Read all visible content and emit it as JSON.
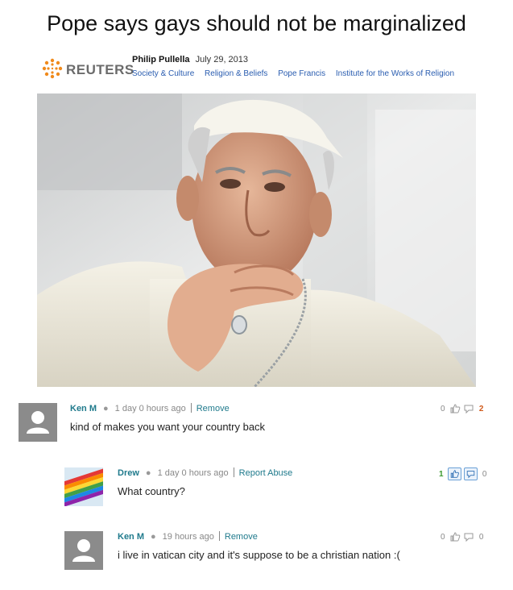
{
  "article": {
    "headline": "Pope says gays should not be marginalized",
    "source_logo_text": "REUTERS",
    "author": "Philip Pullella",
    "date": "July 29, 2013",
    "tags": [
      "Society & Culture",
      "Religion & Beliefs",
      "Pope Francis",
      "Institute for the Works of Religion"
    ]
  },
  "comments": [
    {
      "user": "Ken M",
      "time": "1 day 0 hours ago",
      "action": "Remove",
      "text": "kind of makes you want your country back",
      "up": "0",
      "down": "2",
      "avatar": "default-user-icon"
    },
    {
      "user": "Drew",
      "time": "1 day 0 hours ago",
      "action": "Report Abuse",
      "text": "What country?",
      "up": "1",
      "down": "0",
      "avatar": "rainbow-flag-image"
    },
    {
      "user": "Ken M",
      "time": "19 hours ago",
      "action": "Remove",
      "text": "i live in vatican city and it's suppose to be a christian nation :(",
      "up": "0",
      "down": "0",
      "avatar": "default-user-icon"
    }
  ],
  "colors": {
    "username": "#1f7a8c",
    "tag_link": "#2a5db0",
    "upvote_active": "#3c9a30",
    "downvote_active": "#d05a1b",
    "reuters_orange": "#f08a1c"
  }
}
